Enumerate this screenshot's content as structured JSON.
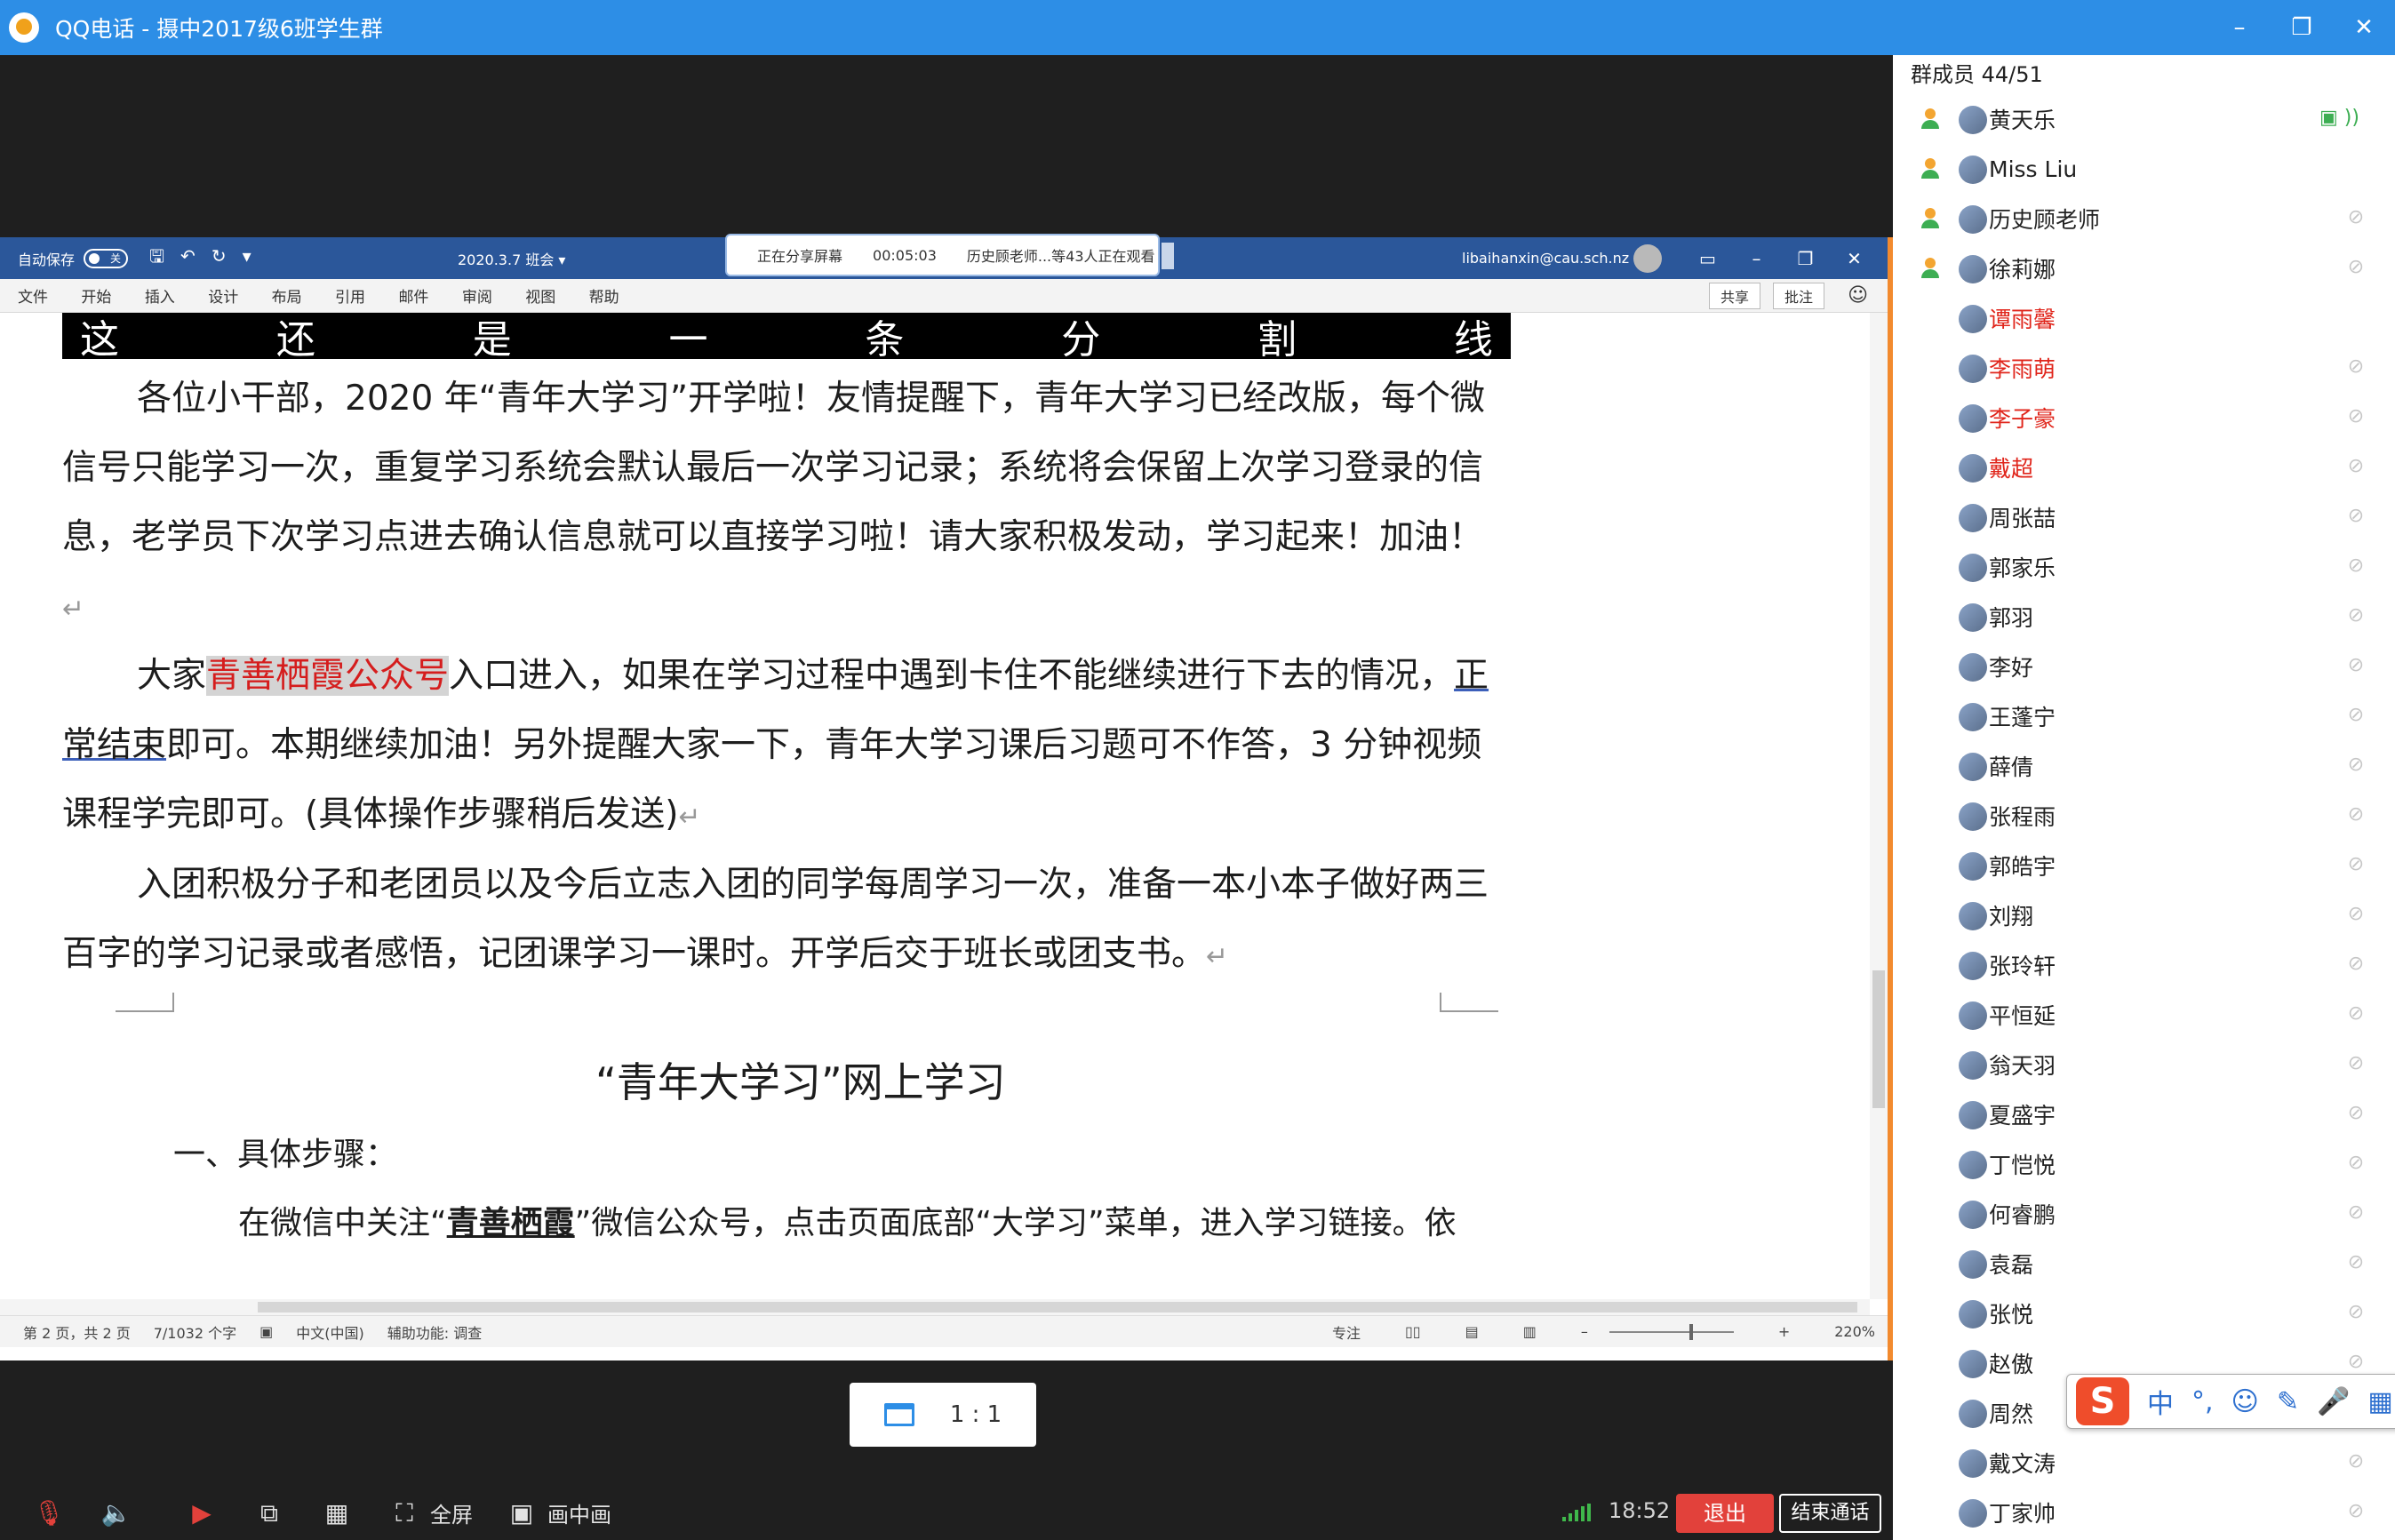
{
  "window": {
    "title": "QQ电话 - 摄中2017级6班学生群"
  },
  "word": {
    "autosave_label": "自动保存",
    "autosave_state": "关",
    "doc_name": "2020.3.7 班会 ▾",
    "user_email": "libaihanxin@cau.sch.nz",
    "menus": [
      "文件",
      "开始",
      "插入",
      "设计",
      "布局",
      "引用",
      "邮件",
      "审阅",
      "视图",
      "帮助"
    ],
    "share_label": "共享",
    "comment_label": "批注"
  },
  "share_popup": {
    "status": "正在分享屏幕",
    "timer": "00:05:03",
    "viewers": "历史顾老师...等43人正在观看"
  },
  "document": {
    "divider_chars": [
      "这",
      "还",
      "是",
      "一",
      "条",
      "分",
      "割",
      "线"
    ],
    "p1": "各位小干部，2020 年“青年大学习”开学啦！友情提醒下，青年大学习已经改版，每个微信号只能学习一次，重复学习系统会默认最后一次学习记录；系统将会保留上次学习登录的信息，老学员下次学习点进去确认信息就可以直接学习啦！请大家积极发动，学习起来！加油！",
    "p2_a": "大家",
    "p2_hl": "青善栖霞公众号",
    "p2_b": "入口进入，如果在学习过程中遇到卡住不能继续进行下去的情况，",
    "p2_ul": "正常结束",
    "p2_c": "即可。本期继续加油！另外提醒大家一下，青年大学习课后习题可不作答，3 分钟视频课程学完即可。(具体操作步骤稍后发送)",
    "p3": "入团积极分子和老团员以及今后立志入团的同学每周学习一次，准备一本小本子做好两三百字的学习记录或者感悟，记团课学习一课时。开学后交于班长或团支书。",
    "title": "“青年大学习”网上学习",
    "step1": "一、具体步骤：",
    "step_text_a": "在微信中关注“",
    "step_text_b": "青善栖霞",
    "step_text_c": "”微信公众号，点击页面底部“大学习”菜单，进入学习链接。依"
  },
  "status": {
    "page": "第 2 页，共 2 页",
    "words": "7/1032 个字",
    "lang": "中文(中国)",
    "access": "辅助功能: 调查",
    "focus": "专注",
    "zoom": "220%"
  },
  "ratio_btn": "1 : 1",
  "toolbar": {
    "fullscreen": "全屏",
    "pip": "画中画",
    "time": "18:52",
    "exit": "退出",
    "end_call": "结束通话"
  },
  "members": {
    "header": "群成员 44/51",
    "list": [
      {
        "name": "黄天乐",
        "role": true,
        "red": false,
        "state": "speaking"
      },
      {
        "name": "Miss Liu",
        "role": true,
        "red": false,
        "state": ""
      },
      {
        "name": "历史顾老师",
        "role": true,
        "red": false,
        "state": "muted"
      },
      {
        "name": "徐莉娜",
        "role": true,
        "red": false,
        "state": "muted"
      },
      {
        "name": "谭雨馨",
        "role": false,
        "red": true,
        "state": ""
      },
      {
        "name": "李雨萌",
        "role": false,
        "red": true,
        "state": "muted"
      },
      {
        "name": "李子豪",
        "role": false,
        "red": true,
        "state": "muted"
      },
      {
        "name": "戴超",
        "role": false,
        "red": true,
        "state": "muted"
      },
      {
        "name": "周张喆",
        "role": false,
        "red": false,
        "state": "muted"
      },
      {
        "name": "郭家乐",
        "role": false,
        "red": false,
        "state": "muted"
      },
      {
        "name": "郭羽",
        "role": false,
        "red": false,
        "state": "muted"
      },
      {
        "name": "李好",
        "role": false,
        "red": false,
        "state": "muted"
      },
      {
        "name": "王蓬宁",
        "role": false,
        "red": false,
        "state": "muted"
      },
      {
        "name": "薛倩",
        "role": false,
        "red": false,
        "state": "muted"
      },
      {
        "name": "张程雨",
        "role": false,
        "red": false,
        "state": "muted"
      },
      {
        "name": "郭皓宇",
        "role": false,
        "red": false,
        "state": "muted"
      },
      {
        "name": "刘翔",
        "role": false,
        "red": false,
        "state": "muted"
      },
      {
        "name": "张玲轩",
        "role": false,
        "red": false,
        "state": "muted"
      },
      {
        "name": "平恒延",
        "role": false,
        "red": false,
        "state": "muted"
      },
      {
        "name": "翁天羽",
        "role": false,
        "red": false,
        "state": "muted"
      },
      {
        "name": "夏盛宇",
        "role": false,
        "red": false,
        "state": "muted"
      },
      {
        "name": "丁恺悦",
        "role": false,
        "red": false,
        "state": "muted"
      },
      {
        "name": "何睿鹏",
        "role": false,
        "red": false,
        "state": "muted"
      },
      {
        "name": "袁磊",
        "role": false,
        "red": false,
        "state": "muted"
      },
      {
        "name": "张悦",
        "role": false,
        "red": false,
        "state": "muted"
      },
      {
        "name": "赵傲",
        "role": false,
        "red": false,
        "state": "muted"
      },
      {
        "name": "周然",
        "role": false,
        "red": false,
        "state": "muted"
      },
      {
        "name": "戴文涛",
        "role": false,
        "red": false,
        "state": "muted"
      },
      {
        "name": "丁家帅",
        "role": false,
        "red": false,
        "state": "muted"
      }
    ]
  },
  "ime": {
    "logo": "S",
    "mode": "中",
    "punct": "°,"
  }
}
